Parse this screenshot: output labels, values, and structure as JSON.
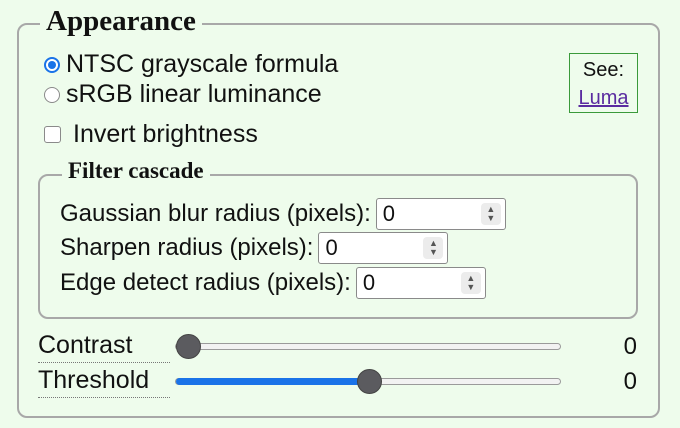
{
  "appearance": {
    "legend": "Appearance",
    "radios": [
      {
        "label": "NTSC grayscale formula",
        "checked": true
      },
      {
        "label": "sRGB linear luminance",
        "checked": false
      }
    ],
    "see_label": "See:",
    "see_link": "Luma",
    "invert_label": "Invert brightness",
    "invert_checked": false
  },
  "filter_cascade": {
    "legend": "Filter cascade",
    "fields": [
      {
        "label": "Gaussian blur radius (pixels):",
        "value": "0"
      },
      {
        "label": "Sharpen radius (pixels):",
        "value": "0"
      },
      {
        "label": "Edge detect radius (pixels):",
        "value": "0"
      }
    ]
  },
  "sliders": [
    {
      "label": "Contrast",
      "value": "0",
      "fill_fraction": 0.0
    },
    {
      "label": "Threshold",
      "value": "0",
      "fill_fraction": 0.5
    }
  ],
  "colors": {
    "accent": "#1a73e8",
    "background": "#eefcec",
    "link": "#5a2ca0"
  }
}
